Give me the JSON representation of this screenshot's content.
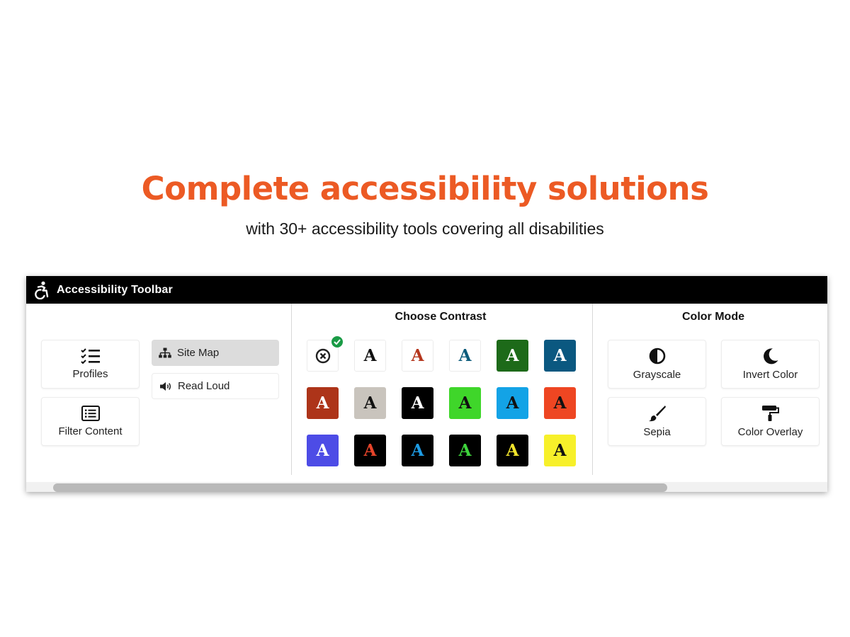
{
  "page": {
    "headline": "Complete accessibility solutions",
    "subheadline": "with 30+ accessibility tools covering all disabilities",
    "headline_color": "#ec5a24"
  },
  "toolbar": {
    "title": "Accessibility Toolbar",
    "icon": "wheelchair-icon",
    "left_panel": {
      "tiles": [
        {
          "label": "Profiles",
          "icon": "checklist-icon"
        },
        {
          "label": "Filter Content",
          "icon": "list-icon"
        }
      ],
      "pills": [
        {
          "label": "Site Map",
          "icon": "sitemap-icon",
          "active": true
        },
        {
          "label": "Read Loud",
          "icon": "speaker-icon",
          "active": false
        }
      ]
    },
    "contrast": {
      "title": "Choose Contrast",
      "glyph": "A",
      "swatches": [
        {
          "bg": "#ffffff",
          "fg": "#222222",
          "type": "reset",
          "selected": true
        },
        {
          "bg": "#ffffff",
          "fg": "#111111"
        },
        {
          "bg": "#ffffff",
          "fg": "#b5361d"
        },
        {
          "bg": "#ffffff",
          "fg": "#0d5c7c"
        },
        {
          "bg": "#1d6a19",
          "fg": "#ffffff"
        },
        {
          "bg": "#0b5880",
          "fg": "#ffffff"
        },
        {
          "bg": "#ad3419",
          "fg": "#ffffff"
        },
        {
          "bg": "#c9c4bd",
          "fg": "#111111"
        },
        {
          "bg": "#000000",
          "fg": "#ffffff"
        },
        {
          "bg": "#3fd62a",
          "fg": "#111111"
        },
        {
          "bg": "#13a3e6",
          "fg": "#111111"
        },
        {
          "bg": "#ee4622",
          "fg": "#111111"
        },
        {
          "bg": "#4d4ce6",
          "fg": "#ffffff"
        },
        {
          "bg": "#000000",
          "fg": "#e6442a"
        },
        {
          "bg": "#000000",
          "fg": "#1e9be3"
        },
        {
          "bg": "#000000",
          "fg": "#3ed43c"
        },
        {
          "bg": "#000000",
          "fg": "#f2e52c"
        },
        {
          "bg": "#f7f02a",
          "fg": "#111111"
        }
      ]
    },
    "color_mode": {
      "title": "Color Mode",
      "tiles": [
        {
          "label": "Grayscale",
          "icon": "half-circle-icon"
        },
        {
          "label": "Invert Color",
          "icon": "moon-icon"
        },
        {
          "label": "Sepia",
          "icon": "paintbrush-icon"
        },
        {
          "label": "Color Overlay",
          "icon": "paint-roller-icon"
        }
      ]
    }
  }
}
